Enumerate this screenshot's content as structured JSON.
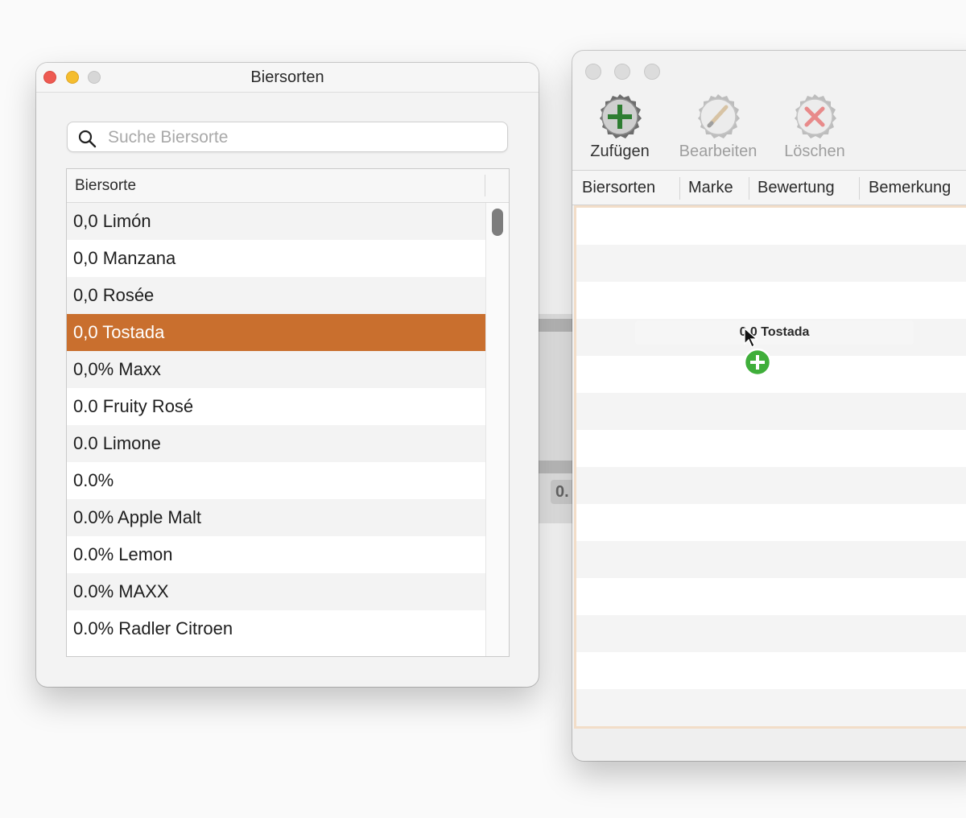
{
  "background_window": {
    "chip_text": "0."
  },
  "left_window": {
    "title": "Biersorten",
    "search": {
      "placeholder": "Suche Biersorte",
      "value": ""
    },
    "table": {
      "column_header": "Biersorte",
      "selected_index": 3,
      "rows": [
        "0,0 Limón",
        "0,0 Manzana",
        "0,0 Rosée",
        "0,0 Tostada",
        "0,0% Maxx",
        "0.0 Fruity Rosé",
        "0.0 Limone",
        "0.0%",
        "0.0% Apple Malt",
        "0.0% Lemon",
        "0.0% MAXX",
        "0.0% Radler Citroen"
      ]
    }
  },
  "right_window": {
    "toolbar": {
      "add_label": "Zufügen",
      "edit_label": "Bearbeiten",
      "delete_label": "Löschen"
    },
    "table": {
      "columns": [
        "Biersorten",
        "Marke",
        "Bewertung",
        "Bemerkung"
      ]
    },
    "drag": {
      "item_label": "0,0 Tostada"
    }
  },
  "colors": {
    "selection": "#c96f2e",
    "add_icon": "#2e7d32",
    "delete_icon": "#e57373",
    "drop_target_border": "#f2ddc8"
  },
  "icons": {
    "search": "magnifier-icon",
    "add": "bottle-cap-plus-icon",
    "edit": "bottle-cap-pencil-icon",
    "delete": "bottle-cap-x-icon",
    "cursor": "arrow-cursor-icon",
    "copy": "green-plus-badge-icon"
  }
}
